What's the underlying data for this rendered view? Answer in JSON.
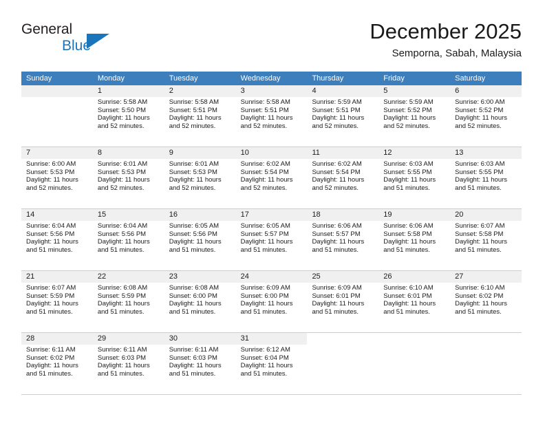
{
  "logo": {
    "line1": "General",
    "line2": "Blue",
    "triangle_color": "#1b75bb",
    "icon": "triangle-icon"
  },
  "header": {
    "month_title": "December 2025",
    "location": "Semporna, Sabah, Malaysia"
  },
  "colors": {
    "header_row_bg": "#3d7ebd",
    "day_number_bg": "#f0f0f0",
    "grid_line": "#cdcdcd",
    "brand_blue": "#1b75bb",
    "text": "#1a1a1a"
  },
  "weekdays": [
    "Sunday",
    "Monday",
    "Tuesday",
    "Wednesday",
    "Thursday",
    "Friday",
    "Saturday"
  ],
  "weeks": [
    [
      {
        "day": "",
        "sunrise": "",
        "sunset": "",
        "daylight1": "",
        "daylight2": "",
        "empty": true
      },
      {
        "day": "1",
        "sunrise": "Sunrise: 5:58 AM",
        "sunset": "Sunset: 5:50 PM",
        "daylight1": "Daylight: 11 hours",
        "daylight2": "and 52 minutes."
      },
      {
        "day": "2",
        "sunrise": "Sunrise: 5:58 AM",
        "sunset": "Sunset: 5:51 PM",
        "daylight1": "Daylight: 11 hours",
        "daylight2": "and 52 minutes."
      },
      {
        "day": "3",
        "sunrise": "Sunrise: 5:58 AM",
        "sunset": "Sunset: 5:51 PM",
        "daylight1": "Daylight: 11 hours",
        "daylight2": "and 52 minutes."
      },
      {
        "day": "4",
        "sunrise": "Sunrise: 5:59 AM",
        "sunset": "Sunset: 5:51 PM",
        "daylight1": "Daylight: 11 hours",
        "daylight2": "and 52 minutes."
      },
      {
        "day": "5",
        "sunrise": "Sunrise: 5:59 AM",
        "sunset": "Sunset: 5:52 PM",
        "daylight1": "Daylight: 11 hours",
        "daylight2": "and 52 minutes."
      },
      {
        "day": "6",
        "sunrise": "Sunrise: 6:00 AM",
        "sunset": "Sunset: 5:52 PM",
        "daylight1": "Daylight: 11 hours",
        "daylight2": "and 52 minutes."
      }
    ],
    [
      {
        "day": "7",
        "sunrise": "Sunrise: 6:00 AM",
        "sunset": "Sunset: 5:53 PM",
        "daylight1": "Daylight: 11 hours",
        "daylight2": "and 52 minutes."
      },
      {
        "day": "8",
        "sunrise": "Sunrise: 6:01 AM",
        "sunset": "Sunset: 5:53 PM",
        "daylight1": "Daylight: 11 hours",
        "daylight2": "and 52 minutes."
      },
      {
        "day": "9",
        "sunrise": "Sunrise: 6:01 AM",
        "sunset": "Sunset: 5:53 PM",
        "daylight1": "Daylight: 11 hours",
        "daylight2": "and 52 minutes."
      },
      {
        "day": "10",
        "sunrise": "Sunrise: 6:02 AM",
        "sunset": "Sunset: 5:54 PM",
        "daylight1": "Daylight: 11 hours",
        "daylight2": "and 52 minutes."
      },
      {
        "day": "11",
        "sunrise": "Sunrise: 6:02 AM",
        "sunset": "Sunset: 5:54 PM",
        "daylight1": "Daylight: 11 hours",
        "daylight2": "and 52 minutes."
      },
      {
        "day": "12",
        "sunrise": "Sunrise: 6:03 AM",
        "sunset": "Sunset: 5:55 PM",
        "daylight1": "Daylight: 11 hours",
        "daylight2": "and 51 minutes."
      },
      {
        "day": "13",
        "sunrise": "Sunrise: 6:03 AM",
        "sunset": "Sunset: 5:55 PM",
        "daylight1": "Daylight: 11 hours",
        "daylight2": "and 51 minutes."
      }
    ],
    [
      {
        "day": "14",
        "sunrise": "Sunrise: 6:04 AM",
        "sunset": "Sunset: 5:56 PM",
        "daylight1": "Daylight: 11 hours",
        "daylight2": "and 51 minutes."
      },
      {
        "day": "15",
        "sunrise": "Sunrise: 6:04 AM",
        "sunset": "Sunset: 5:56 PM",
        "daylight1": "Daylight: 11 hours",
        "daylight2": "and 51 minutes."
      },
      {
        "day": "16",
        "sunrise": "Sunrise: 6:05 AM",
        "sunset": "Sunset: 5:56 PM",
        "daylight1": "Daylight: 11 hours",
        "daylight2": "and 51 minutes."
      },
      {
        "day": "17",
        "sunrise": "Sunrise: 6:05 AM",
        "sunset": "Sunset: 5:57 PM",
        "daylight1": "Daylight: 11 hours",
        "daylight2": "and 51 minutes."
      },
      {
        "day": "18",
        "sunrise": "Sunrise: 6:06 AM",
        "sunset": "Sunset: 5:57 PM",
        "daylight1": "Daylight: 11 hours",
        "daylight2": "and 51 minutes."
      },
      {
        "day": "19",
        "sunrise": "Sunrise: 6:06 AM",
        "sunset": "Sunset: 5:58 PM",
        "daylight1": "Daylight: 11 hours",
        "daylight2": "and 51 minutes."
      },
      {
        "day": "20",
        "sunrise": "Sunrise: 6:07 AM",
        "sunset": "Sunset: 5:58 PM",
        "daylight1": "Daylight: 11 hours",
        "daylight2": "and 51 minutes."
      }
    ],
    [
      {
        "day": "21",
        "sunrise": "Sunrise: 6:07 AM",
        "sunset": "Sunset: 5:59 PM",
        "daylight1": "Daylight: 11 hours",
        "daylight2": "and 51 minutes."
      },
      {
        "day": "22",
        "sunrise": "Sunrise: 6:08 AM",
        "sunset": "Sunset: 5:59 PM",
        "daylight1": "Daylight: 11 hours",
        "daylight2": "and 51 minutes."
      },
      {
        "day": "23",
        "sunrise": "Sunrise: 6:08 AM",
        "sunset": "Sunset: 6:00 PM",
        "daylight1": "Daylight: 11 hours",
        "daylight2": "and 51 minutes."
      },
      {
        "day": "24",
        "sunrise": "Sunrise: 6:09 AM",
        "sunset": "Sunset: 6:00 PM",
        "daylight1": "Daylight: 11 hours",
        "daylight2": "and 51 minutes."
      },
      {
        "day": "25",
        "sunrise": "Sunrise: 6:09 AM",
        "sunset": "Sunset: 6:01 PM",
        "daylight1": "Daylight: 11 hours",
        "daylight2": "and 51 minutes."
      },
      {
        "day": "26",
        "sunrise": "Sunrise: 6:10 AM",
        "sunset": "Sunset: 6:01 PM",
        "daylight1": "Daylight: 11 hours",
        "daylight2": "and 51 minutes."
      },
      {
        "day": "27",
        "sunrise": "Sunrise: 6:10 AM",
        "sunset": "Sunset: 6:02 PM",
        "daylight1": "Daylight: 11 hours",
        "daylight2": "and 51 minutes."
      }
    ],
    [
      {
        "day": "28",
        "sunrise": "Sunrise: 6:11 AM",
        "sunset": "Sunset: 6:02 PM",
        "daylight1": "Daylight: 11 hours",
        "daylight2": "and 51 minutes."
      },
      {
        "day": "29",
        "sunrise": "Sunrise: 6:11 AM",
        "sunset": "Sunset: 6:03 PM",
        "daylight1": "Daylight: 11 hours",
        "daylight2": "and 51 minutes."
      },
      {
        "day": "30",
        "sunrise": "Sunrise: 6:11 AM",
        "sunset": "Sunset: 6:03 PM",
        "daylight1": "Daylight: 11 hours",
        "daylight2": "and 51 minutes."
      },
      {
        "day": "31",
        "sunrise": "Sunrise: 6:12 AM",
        "sunset": "Sunset: 6:04 PM",
        "daylight1": "Daylight: 11 hours",
        "daylight2": "and 51 minutes."
      },
      {
        "day": "",
        "sunrise": "",
        "sunset": "",
        "daylight1": "",
        "daylight2": "",
        "blank": true
      },
      {
        "day": "",
        "sunrise": "",
        "sunset": "",
        "daylight1": "",
        "daylight2": "",
        "blank": true
      },
      {
        "day": "",
        "sunrise": "",
        "sunset": "",
        "daylight1": "",
        "daylight2": "",
        "blank": true
      }
    ]
  ]
}
